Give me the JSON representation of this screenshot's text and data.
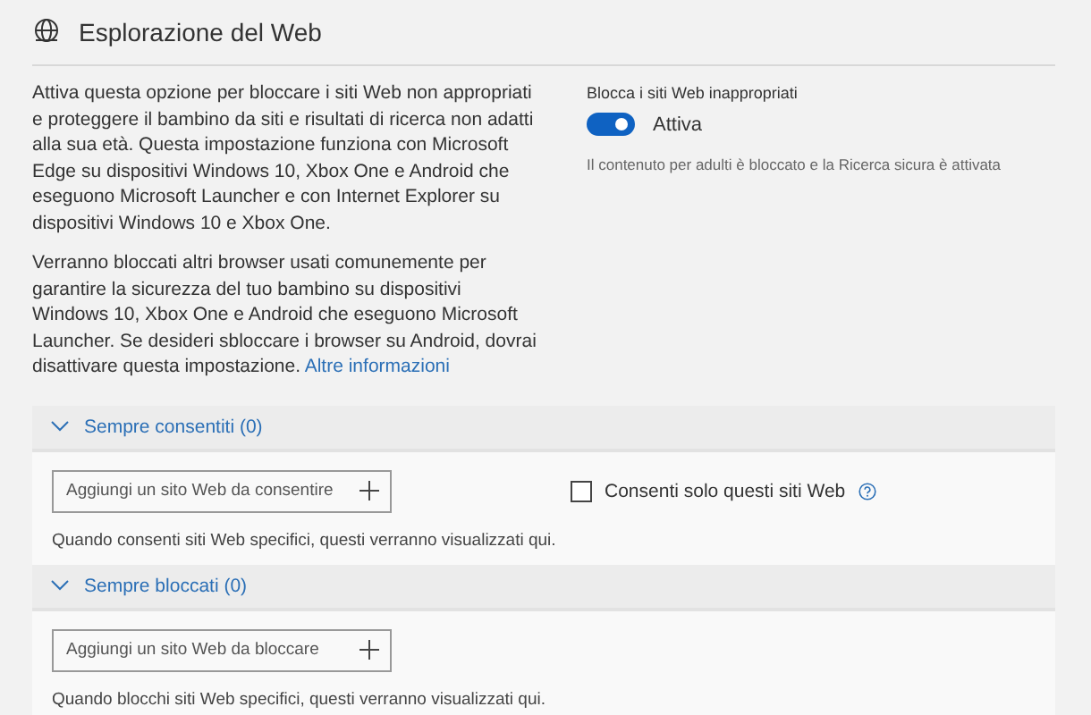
{
  "header": {
    "title": "Esplorazione del Web"
  },
  "description": [
    "Attiva questa opzione per bloccare i siti Web non appropriati e proteggere il bambino da siti e risultati di ricerca non adatti alla sua età. Questa impostazione funziona con Microsoft Edge su dispositivi Windows 10, Xbox One e Android che eseguono Microsoft Launcher e con Internet Explorer su dispositivi Windows 10 e Xbox One.",
    "Verranno bloccati altri browser usati comunemente per garantire la sicurezza del tuo bambino su dispositivi Windows 10, Xbox One e Android che eseguono Microsoft Launcher. Se desideri sbloccare i browser su Android, dovrai disattivare questa impostazione."
  ],
  "more_link": "Altre informazioni",
  "setting": {
    "label": "Blocca i siti Web inappropriati",
    "toggle": {
      "on": true,
      "label": "Attiva"
    },
    "note": "Il contenuto per adulti è bloccato e la Ricerca sicura è attivata"
  },
  "sections": [
    {
      "title": "Sempre consentiti (0)",
      "expanded": true,
      "placeholder": "Aggiungi un sito Web da consentire",
      "checkbox": {
        "label": "Consenti solo questi siti Web",
        "checked": false
      },
      "empty_text": "Quando consenti siti Web specifici, questi verranno visualizzati qui."
    },
    {
      "title": "Sempre bloccati (0)",
      "expanded": true,
      "placeholder": "Aggiungi un sito Web da bloccare",
      "empty_text": "Quando blocchi siti Web specifici, questi verranno visualizzati qui."
    }
  ]
}
